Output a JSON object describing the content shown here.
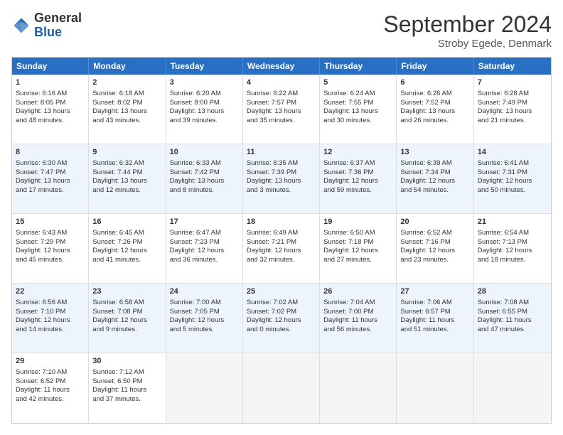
{
  "header": {
    "logo": {
      "general": "General",
      "blue": "Blue"
    },
    "title": "September 2024",
    "subtitle": "Stroby Egede, Denmark"
  },
  "days_of_week": [
    "Sunday",
    "Monday",
    "Tuesday",
    "Wednesday",
    "Thursday",
    "Friday",
    "Saturday"
  ],
  "weeks": [
    [
      {
        "num": "1",
        "data": "Sunrise: 6:16 AM\nSunset: 8:05 PM\nDaylight: 13 hours\nand 48 minutes."
      },
      {
        "num": "2",
        "data": "Sunrise: 6:18 AM\nSunset: 8:02 PM\nDaylight: 13 hours\nand 43 minutes."
      },
      {
        "num": "3",
        "data": "Sunrise: 6:20 AM\nSunset: 8:00 PM\nDaylight: 13 hours\nand 39 minutes."
      },
      {
        "num": "4",
        "data": "Sunrise: 6:22 AM\nSunset: 7:57 PM\nDaylight: 13 hours\nand 35 minutes."
      },
      {
        "num": "5",
        "data": "Sunrise: 6:24 AM\nSunset: 7:55 PM\nDaylight: 13 hours\nand 30 minutes."
      },
      {
        "num": "6",
        "data": "Sunrise: 6:26 AM\nSunset: 7:52 PM\nDaylight: 13 hours\nand 26 minutes."
      },
      {
        "num": "7",
        "data": "Sunrise: 6:28 AM\nSunset: 7:49 PM\nDaylight: 13 hours\nand 21 minutes."
      }
    ],
    [
      {
        "num": "8",
        "data": "Sunrise: 6:30 AM\nSunset: 7:47 PM\nDaylight: 13 hours\nand 17 minutes."
      },
      {
        "num": "9",
        "data": "Sunrise: 6:32 AM\nSunset: 7:44 PM\nDaylight: 13 hours\nand 12 minutes."
      },
      {
        "num": "10",
        "data": "Sunrise: 6:33 AM\nSunset: 7:42 PM\nDaylight: 13 hours\nand 8 minutes."
      },
      {
        "num": "11",
        "data": "Sunrise: 6:35 AM\nSunset: 7:39 PM\nDaylight: 13 hours\nand 3 minutes."
      },
      {
        "num": "12",
        "data": "Sunrise: 6:37 AM\nSunset: 7:36 PM\nDaylight: 12 hours\nand 59 minutes."
      },
      {
        "num": "13",
        "data": "Sunrise: 6:39 AM\nSunset: 7:34 PM\nDaylight: 12 hours\nand 54 minutes."
      },
      {
        "num": "14",
        "data": "Sunrise: 6:41 AM\nSunset: 7:31 PM\nDaylight: 12 hours\nand 50 minutes."
      }
    ],
    [
      {
        "num": "15",
        "data": "Sunrise: 6:43 AM\nSunset: 7:29 PM\nDaylight: 12 hours\nand 45 minutes."
      },
      {
        "num": "16",
        "data": "Sunrise: 6:45 AM\nSunset: 7:26 PM\nDaylight: 12 hours\nand 41 minutes."
      },
      {
        "num": "17",
        "data": "Sunrise: 6:47 AM\nSunset: 7:23 PM\nDaylight: 12 hours\nand 36 minutes."
      },
      {
        "num": "18",
        "data": "Sunrise: 6:49 AM\nSunset: 7:21 PM\nDaylight: 12 hours\nand 32 minutes."
      },
      {
        "num": "19",
        "data": "Sunrise: 6:50 AM\nSunset: 7:18 PM\nDaylight: 12 hours\nand 27 minutes."
      },
      {
        "num": "20",
        "data": "Sunrise: 6:52 AM\nSunset: 7:16 PM\nDaylight: 12 hours\nand 23 minutes."
      },
      {
        "num": "21",
        "data": "Sunrise: 6:54 AM\nSunset: 7:13 PM\nDaylight: 12 hours\nand 18 minutes."
      }
    ],
    [
      {
        "num": "22",
        "data": "Sunrise: 6:56 AM\nSunset: 7:10 PM\nDaylight: 12 hours\nand 14 minutes."
      },
      {
        "num": "23",
        "data": "Sunrise: 6:58 AM\nSunset: 7:08 PM\nDaylight: 12 hours\nand 9 minutes."
      },
      {
        "num": "24",
        "data": "Sunrise: 7:00 AM\nSunset: 7:05 PM\nDaylight: 12 hours\nand 5 minutes."
      },
      {
        "num": "25",
        "data": "Sunrise: 7:02 AM\nSunset: 7:02 PM\nDaylight: 12 hours\nand 0 minutes."
      },
      {
        "num": "26",
        "data": "Sunrise: 7:04 AM\nSunset: 7:00 PM\nDaylight: 11 hours\nand 56 minutes."
      },
      {
        "num": "27",
        "data": "Sunrise: 7:06 AM\nSunset: 6:57 PM\nDaylight: 11 hours\nand 51 minutes."
      },
      {
        "num": "28",
        "data": "Sunrise: 7:08 AM\nSunset: 6:55 PM\nDaylight: 11 hours\nand 47 minutes."
      }
    ],
    [
      {
        "num": "29",
        "data": "Sunrise: 7:10 AM\nSunset: 6:52 PM\nDaylight: 11 hours\nand 42 minutes."
      },
      {
        "num": "30",
        "data": "Sunrise: 7:12 AM\nSunset: 6:50 PM\nDaylight: 11 hours\nand 37 minutes."
      },
      {
        "num": "",
        "data": ""
      },
      {
        "num": "",
        "data": ""
      },
      {
        "num": "",
        "data": ""
      },
      {
        "num": "",
        "data": ""
      },
      {
        "num": "",
        "data": ""
      }
    ]
  ]
}
